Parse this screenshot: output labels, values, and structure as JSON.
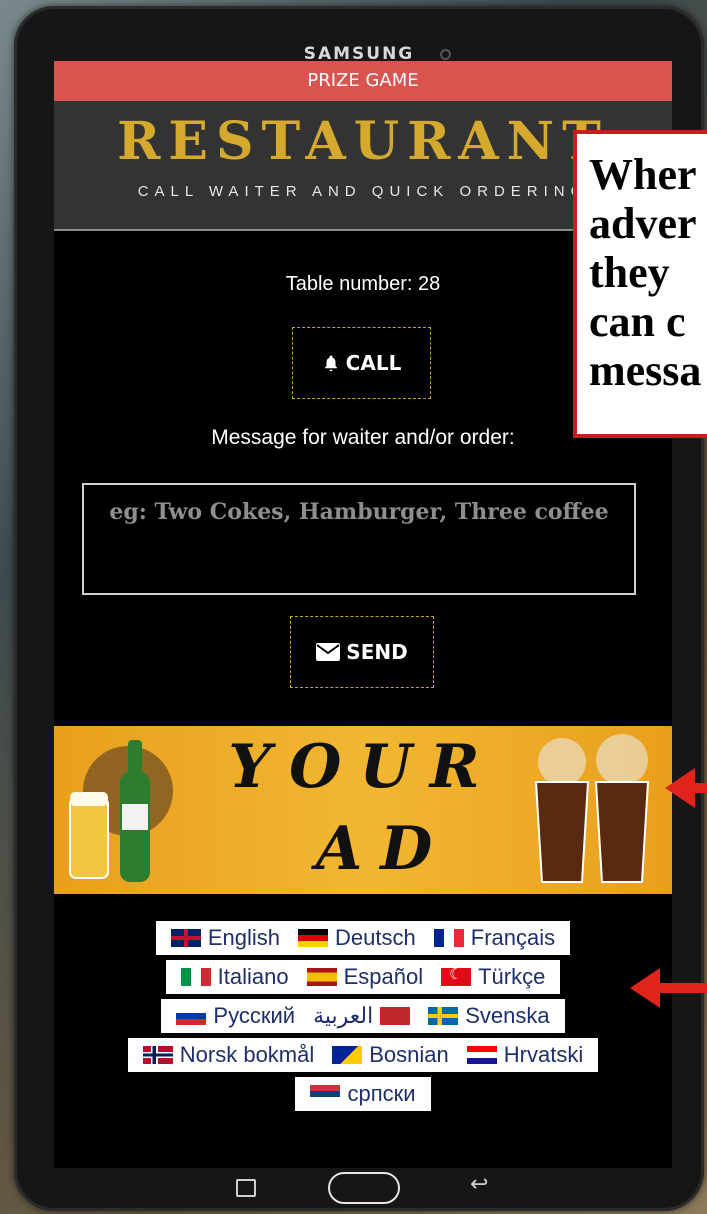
{
  "device": {
    "brand": "SAMSUNG"
  },
  "app": {
    "banner": "PRIZE GAME",
    "title": "RESTAURANT",
    "subtitle": "CALL WAITER AND QUICK ORDERING",
    "table_label": "Table number: 28",
    "call_button": "CALL",
    "message_label": "Message for waiter and/or order:",
    "message_placeholder": "eg: Two Cokes, Hamburger, Three coffee",
    "send_button": "SEND",
    "ad": {
      "line1": "YOUR",
      "line2": "AD"
    }
  },
  "languages": [
    [
      {
        "label": "English",
        "flag": "gb"
      },
      {
        "label": "Deutsch",
        "flag": "de"
      },
      {
        "label": "Français",
        "flag": "fr"
      }
    ],
    [
      {
        "label": "Italiano",
        "flag": "it"
      },
      {
        "label": "Español",
        "flag": "es"
      },
      {
        "label": "Türkçe",
        "flag": "tr"
      }
    ],
    [
      {
        "label": "Русский",
        "flag": "ru"
      },
      {
        "label": "العربية",
        "flag": "ma"
      },
      {
        "label": "Svenska",
        "flag": "se"
      }
    ],
    [
      {
        "label": "Norsk bokmål",
        "flag": "no"
      },
      {
        "label": "Bosnian",
        "flag": "ba"
      },
      {
        "label": "Hrvatski",
        "flag": "hr"
      }
    ],
    [
      {
        "label": "српски",
        "flag": "rs"
      }
    ]
  ],
  "callout": {
    "lines": [
      "Wher",
      "adver",
      "they",
      "can c",
      "messa"
    ]
  },
  "colors": {
    "banner": "#d9534f",
    "title_gold": "#d4a92d",
    "callout_border": "#c91d1d",
    "arrow": "#e0241c"
  }
}
